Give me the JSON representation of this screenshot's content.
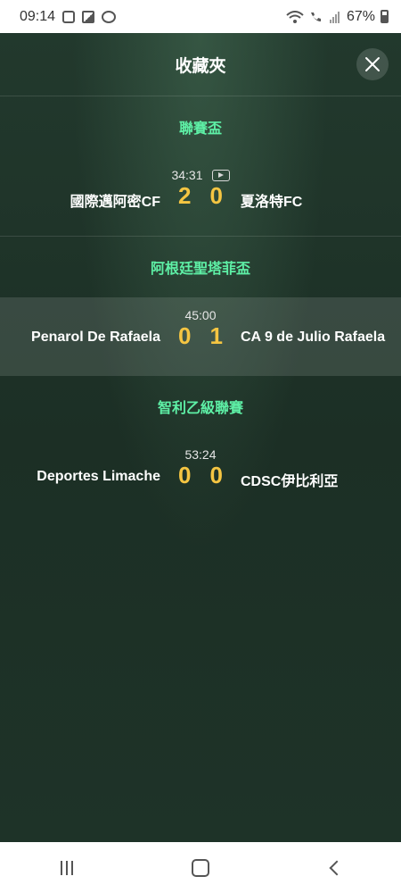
{
  "status_bar": {
    "time": "09:14",
    "battery": "67%"
  },
  "header": {
    "title": "收藏夾"
  },
  "leagues": [
    {
      "name": "聯賽盃",
      "matches": [
        {
          "time": "34:31",
          "home": "國際邁阿密CF",
          "home_score": "2",
          "away_score": "0",
          "away": "夏洛特FC",
          "has_video": true
        }
      ]
    },
    {
      "name": "阿根廷聖塔菲盃",
      "matches": [
        {
          "time": "45:00",
          "home": "Penarol De Rafaela",
          "home_score": "0",
          "away_score": "1",
          "away": "CA 9 de Julio Rafaela",
          "has_video": false
        }
      ]
    },
    {
      "name": "智利乙級聯賽",
      "matches": [
        {
          "time": "53:24",
          "home": "Deportes Limache",
          "home_score": "0",
          "away_score": "0",
          "away": "CDSC伊比利亞",
          "has_video": false
        }
      ]
    }
  ],
  "colors": {
    "league": "#5ef0a6",
    "score": "#f5c542",
    "background": "#1e3328"
  }
}
